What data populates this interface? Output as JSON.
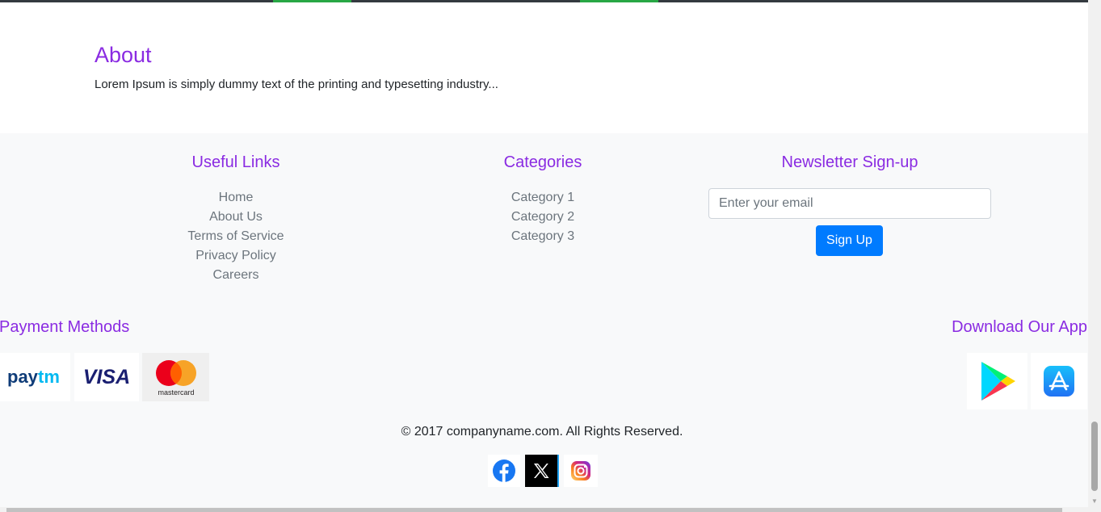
{
  "about": {
    "title": "About",
    "text": "Lorem Ipsum is simply dummy text of the printing and typesetting industry..."
  },
  "useful_links": {
    "title": "Useful Links",
    "items": [
      "Home",
      "About Us",
      "Terms of Service",
      "Privacy Policy",
      "Careers"
    ]
  },
  "categories": {
    "title": "Categories",
    "items": [
      "Category 1",
      "Category 2",
      "Category 3"
    ]
  },
  "newsletter": {
    "title": "Newsletter Sign-up",
    "email_placeholder": "Enter your email",
    "button_label": "Sign Up"
  },
  "payment": {
    "title": "Payment Methods",
    "methods": [
      {
        "name": "Paytm",
        "icon": "paytm-logo"
      },
      {
        "name": "VISA",
        "icon": "visa-logo"
      },
      {
        "name": "mastercard",
        "icon": "mastercard-logo"
      }
    ]
  },
  "download": {
    "title": "Download Our App",
    "stores": [
      {
        "icon": "google-play-icon"
      },
      {
        "icon": "app-store-icon"
      }
    ]
  },
  "copyright": "© 2017 companyname.com. All Rights Reserved.",
  "social": [
    {
      "icon": "facebook-icon"
    },
    {
      "icon": "x-twitter-icon"
    },
    {
      "icon": "instagram-icon"
    }
  ],
  "colors": {
    "heading": "#8a2be2",
    "primary_button": "#007bff",
    "footer_bg": "#f8f9fa",
    "accent_green": "#28a745"
  }
}
